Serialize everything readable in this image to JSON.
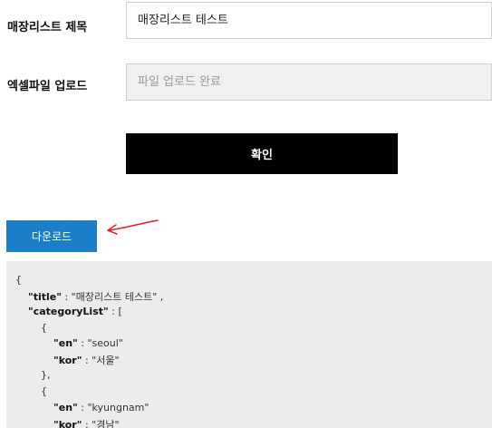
{
  "form": {
    "title_label": "매장리스트 제목",
    "title_value": "매장리스트 테스트",
    "excel_label": "엑셀파일 업로드",
    "excel_value": "파일 업로드 완료",
    "confirm_label": "확인"
  },
  "download": {
    "label": "다운로드"
  },
  "annotation": {
    "arrow_color": "#e02020"
  },
  "colors": {
    "download_bg": "#1a7fc8",
    "confirm_bg": "#000000",
    "panel_bg": "#ececec"
  },
  "json_preview": {
    "open_brace": "{",
    "title_key": "\"title\"",
    "title_rest": " : \"매장리스트 테스트\" ,",
    "category_key": "\"categoryList\"",
    "category_rest": " : [",
    "obj1_open": "{",
    "en1_key": "\"en\"",
    "en1_rest": " : \"seoul\"",
    "kor1_key": "\"kor\"",
    "kor1_rest": " : \"서울\"",
    "obj1_close": "},",
    "obj2_open": "{",
    "en2_key": "\"en\"",
    "en2_rest": " : \"kyungnam\"",
    "kor2_key": "\"kor\"",
    "kor2_rest": " : \"경남\""
  }
}
